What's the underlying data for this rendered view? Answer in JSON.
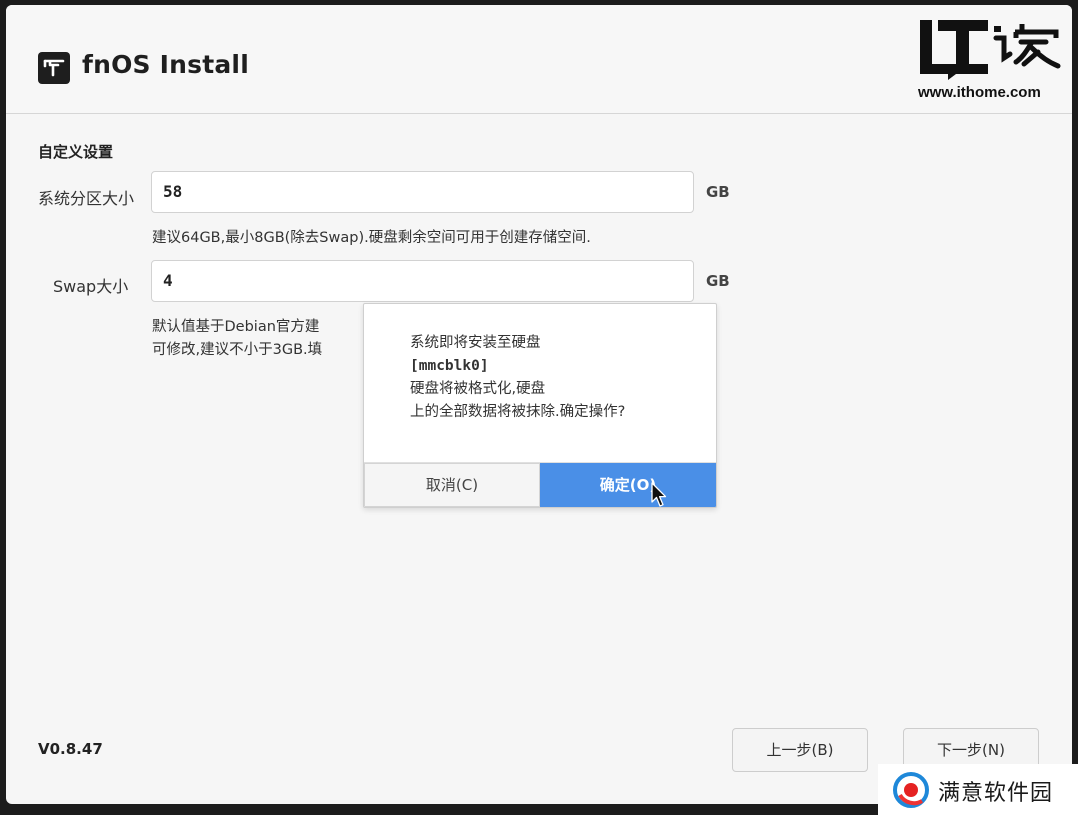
{
  "app": {
    "title": "fnOS Install",
    "version": "V0.8.47"
  },
  "section": {
    "title": "自定义设置"
  },
  "system_partition": {
    "label": "系统分区大小",
    "value": "58",
    "unit": "GB",
    "hint": "建议64GB,最小8GB(除去Swap).硬盘剩余空间可用于创建存储空间."
  },
  "swap": {
    "label": "Swap大小",
    "value": "4",
    "unit": "GB",
    "hint_line1": "默认值基于Debian官方建",
    "hint_line2": "可修改,建议不小于3GB.填"
  },
  "dialog": {
    "line1": "系统即将安装至硬盘",
    "disk": "[mmcblk0]",
    "line3": "硬盘将被格式化,硬盘",
    "line4": "上的全部数据将被抹除.确定操作?",
    "cancel_label": "取消(C)",
    "ok_label": "确定(O)"
  },
  "nav": {
    "back_label": "上一步(B)",
    "next_label": "下一步(N)"
  },
  "watermarks": {
    "ithome_url": "www.ithome.com",
    "app_text": "满意软件园"
  },
  "colors": {
    "accent": "#4a8fe7",
    "background": "#f6f6f6",
    "text": "#333333"
  },
  "icons": {
    "app_logo": "fnos-logo-icon",
    "cursor": "mouse-pointer-icon",
    "app_wm": "app-store-logo-icon"
  }
}
